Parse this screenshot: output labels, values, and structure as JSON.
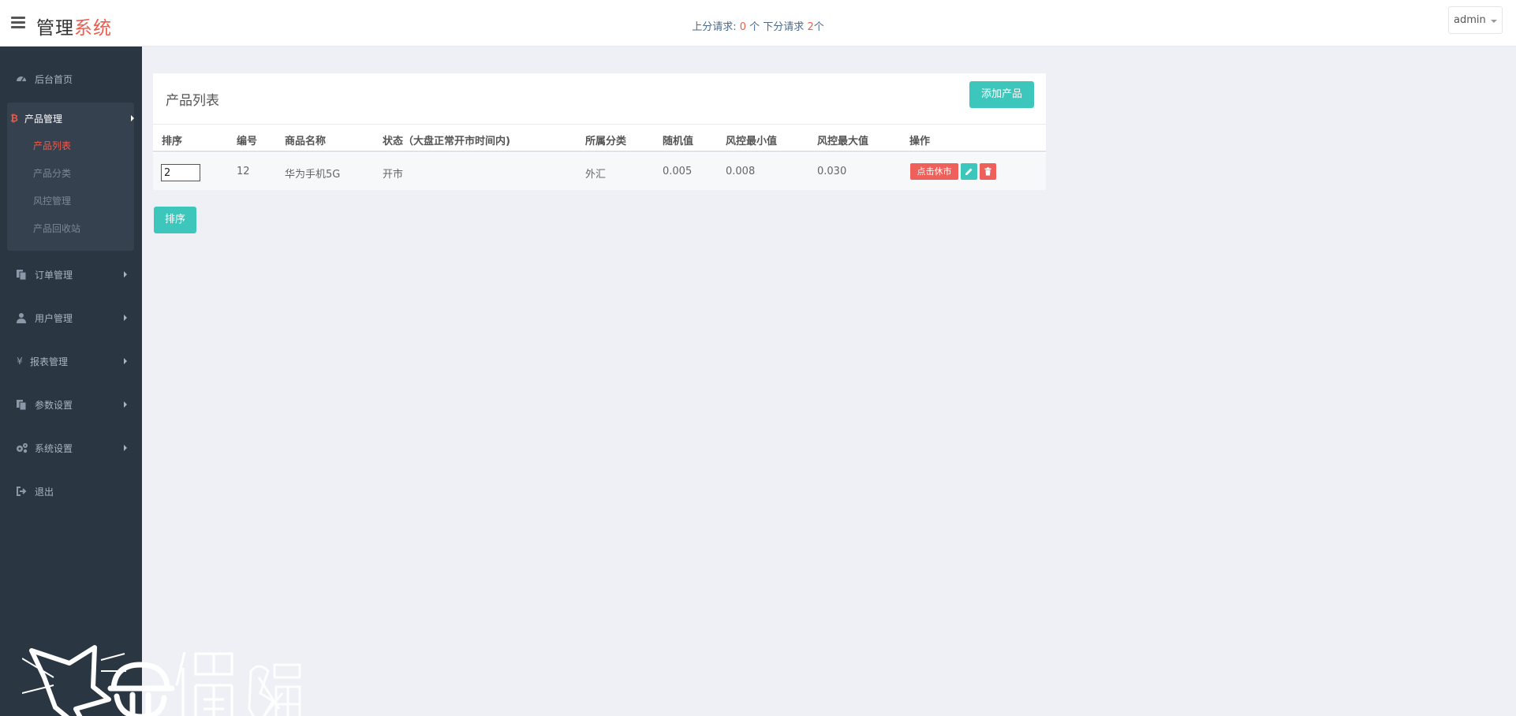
{
  "header": {
    "logo_main": "管理",
    "logo_accent": "系统",
    "req_up_label": "上分请求: ",
    "req_up_count": "0",
    "req_mid": " 个 下分请求 ",
    "req_down_count": "2",
    "req_end": "个",
    "user": "admin"
  },
  "sidebar": {
    "home": "后台首页",
    "product": "产品管理",
    "product_sub": [
      "产品列表",
      "产品分类",
      "风控管理",
      "产品回收站"
    ],
    "orders": "订单管理",
    "users": "用户管理",
    "reports": "报表管理",
    "params": "参数设置",
    "system": "系统设置",
    "logout": "退出"
  },
  "main": {
    "title": "产品列表",
    "add_button": "添加产品",
    "columns": [
      "排序",
      "编号",
      "商品名称",
      "状态（大盘正常开市时间内)",
      "所属分类",
      "随机值",
      "风控最小值",
      "风控最大值",
      "操作"
    ],
    "rows": [
      {
        "sort": "2",
        "id": "12",
        "name": "华为手机5G",
        "status": "开市",
        "category": "外汇",
        "random": "0.005",
        "risk_min": "0.008",
        "risk_max": "0.030",
        "action_close": "点击休市"
      }
    ],
    "sort_button": "排序"
  },
  "colors": {
    "accent_red": "#f05a4a",
    "accent_teal": "#3dc7bc",
    "sidebar_bg": "#2b3643"
  }
}
